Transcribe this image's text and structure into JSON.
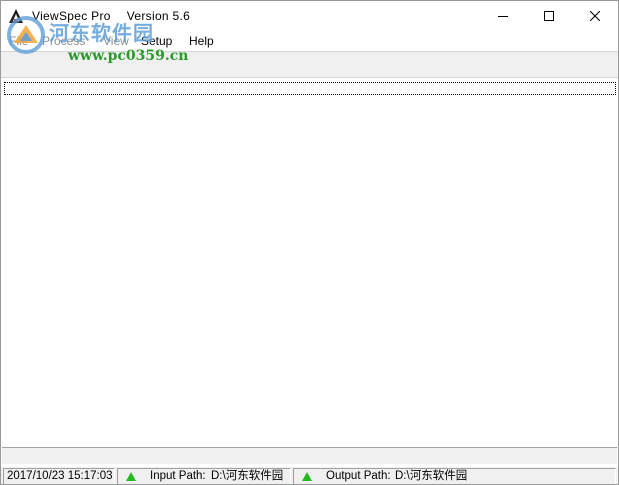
{
  "window": {
    "title": "ViewSpec Pro",
    "version": "Version 5.6",
    "minimize_glyph": "─",
    "maximize_glyph": "☐",
    "close_glyph": "✕"
  },
  "menu": {
    "items": [
      {
        "label": "File",
        "enabled": false
      },
      {
        "label": "Process",
        "enabled": false
      },
      {
        "label": "View",
        "enabled": false
      },
      {
        "label": "Setup",
        "enabled": true
      },
      {
        "label": "Help",
        "enabled": true
      }
    ]
  },
  "watermark": {
    "site_name": "河东软件园",
    "url": "www.pc0359.cn"
  },
  "status": {
    "datetime": "2017/10/23 15:17:03",
    "input_label": "Input Path:",
    "input_value": "D:\\河东软件园",
    "output_label": "Output Path:",
    "output_value": "D:\\河东软件园",
    "indicator_icon": "green-triangle",
    "indicator_color": "#22bb22"
  },
  "colors": {
    "toolbar_bg": "#f0f0f0",
    "watermark_blue": "#5f9fd8",
    "watermark_green": "#2a9a2a"
  }
}
